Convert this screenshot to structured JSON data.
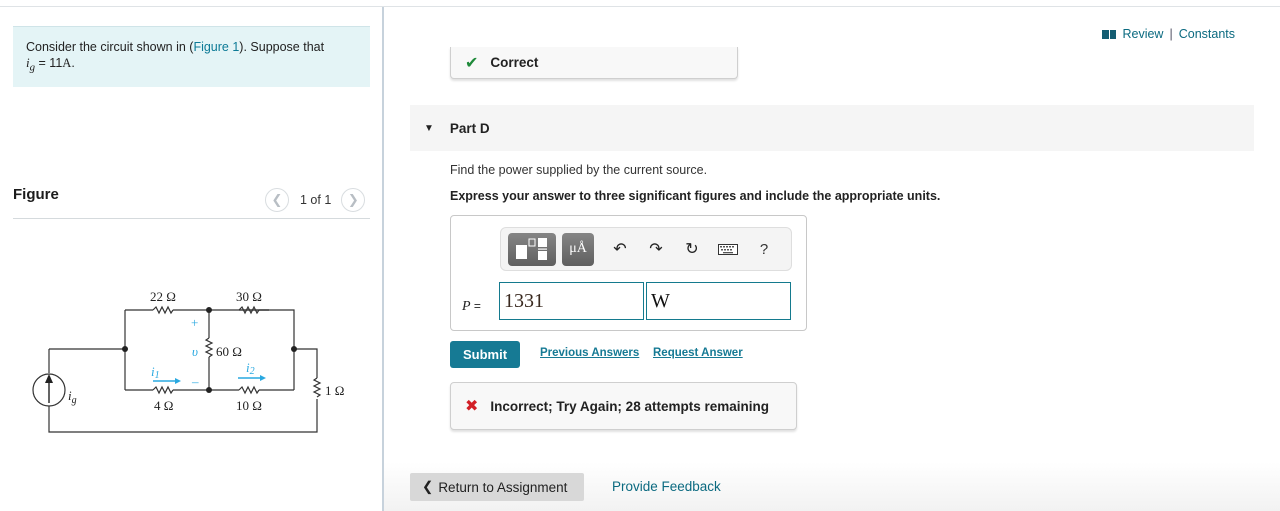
{
  "left": {
    "intro": {
      "text_before": "Consider the circuit shown in (",
      "figure_link": "Figure 1",
      "text_after": "). Suppose that",
      "var": "i",
      "var_sub": "g",
      "eq": " = 11",
      "unit": "A",
      "end": "."
    },
    "figure": {
      "title": "Figure",
      "prev_icon": "chevron-left-icon",
      "next_icon": "chevron-right-icon",
      "count": "1 of 1"
    },
    "circuit": {
      "r_top_left": "22 Ω",
      "r_top_right": "30 Ω",
      "r_middle": "60 Ω",
      "r_bottom_left": "4 Ω",
      "r_bottom_right": "10 Ω",
      "r_load": "1 Ω",
      "v_label": "υ",
      "plus": "+",
      "minus": "–",
      "i1": "i",
      "i1_sub": "1",
      "i2": "i",
      "i2_sub": "2",
      "ig": "i",
      "ig_sub": "g",
      "accent_color": "#29a8e0"
    }
  },
  "right": {
    "review": {
      "icon": "book-icon",
      "review_label": "Review",
      "sep": "|",
      "constants_label": "Constants"
    },
    "previous_feedback": {
      "icon": "check-icon",
      "text": "Correct"
    },
    "part": {
      "icon": "caret-down-icon",
      "title": "Part D"
    },
    "question": "Find the power supplied by the current source.",
    "instruction": "Express your answer to three significant figures and include the appropriate units.",
    "toolbar": {
      "templates_icon": "templates-icon",
      "units_label": "μÅ",
      "undo_icon": "undo-icon",
      "redo_icon": "redo-icon",
      "reset_icon": "reset-icon",
      "keyboard_icon": "keyboard-icon",
      "help_label": "?"
    },
    "answer": {
      "label": "P",
      "eq": " =",
      "value": "1331",
      "unit": "W"
    },
    "submit_label": "Submit",
    "previous_answers_label": "Previous Answers",
    "request_answer_label": "Request Answer",
    "result": {
      "icon": "x-icon",
      "text": "Incorrect; Try Again; 28 attempts remaining"
    },
    "return_label": "Return to Assignment",
    "feedback_label": "Provide Feedback"
  }
}
